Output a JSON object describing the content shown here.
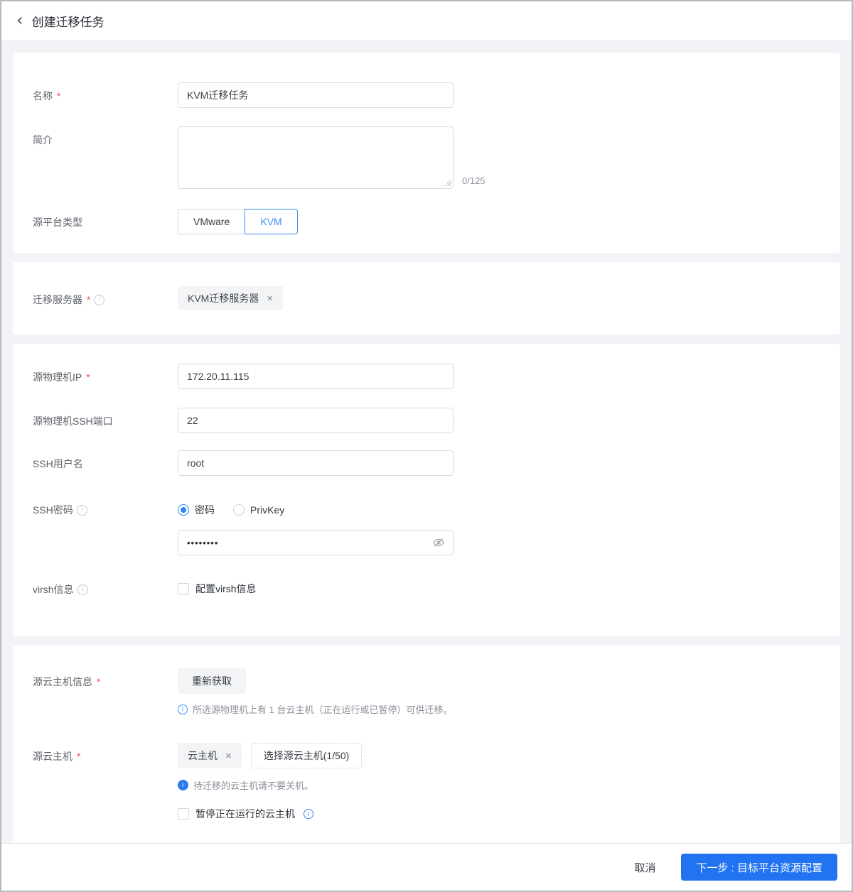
{
  "colors": {
    "primary": "#2273f2",
    "accent": "#3c8df6",
    "required": "#f24c4c"
  },
  "header": {
    "back_icon": "‹",
    "title": "创建迁移任务"
  },
  "form": {
    "basic": {
      "name": {
        "label": "名称",
        "required": "*",
        "value": "KVM迁移任务"
      },
      "desc": {
        "label": "简介",
        "value": "",
        "counter": "0/125"
      },
      "platform": {
        "label": "源平台类型",
        "options": [
          "VMware",
          "KVM"
        ],
        "selected": "KVM"
      }
    },
    "server": {
      "label": "迁移服务器",
      "required": "*",
      "info_icon": "i",
      "tag": "KVM迁移服务器",
      "tag_close": "×"
    },
    "source": {
      "ip": {
        "label": "源物理机IP",
        "required": "*",
        "value": "172.20.11.115"
      },
      "port": {
        "label": "源物理机SSH端口",
        "value": "22"
      },
      "user": {
        "label": "SSH用户名",
        "value": "root"
      },
      "password": {
        "label": "SSH密码",
        "info_icon": "i",
        "options": [
          "密码",
          "PrivKey"
        ],
        "selected": "密码",
        "value": "••••••••"
      },
      "virsh": {
        "label": "virsh信息",
        "info_icon": "i",
        "checkbox_label": "配置virsh信息",
        "checked": false
      }
    },
    "vm_info": {
      "label": "源云主机信息",
      "required": "*",
      "refresh_button": "重新获取",
      "info_icon": "i",
      "hint": "所选源物理机上有 1 台云主机（正在运行或已暂停）可供迁移。"
    },
    "vm": {
      "label": "源云主机",
      "required": "*",
      "tag": "云主机",
      "tag_close": "×",
      "select_button": "选择源云主机(1/50)",
      "info_icon": "i",
      "hint": "待迁移的云主机请不要关机。",
      "pause_checkbox": "暂停正在运行的云主机",
      "pause_checked": false
    }
  },
  "footer": {
    "cancel": "取消",
    "next": "下一步 : 目标平台资源配置"
  }
}
